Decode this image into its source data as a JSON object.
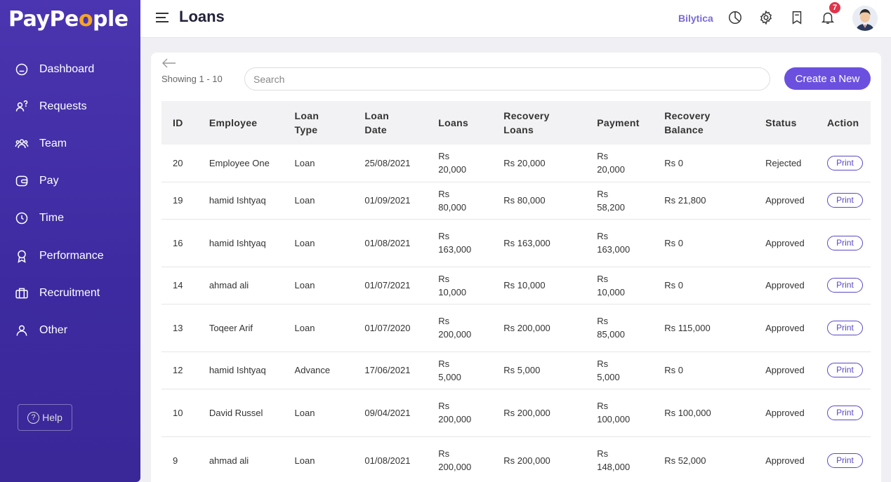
{
  "app": {
    "logo_pre": "PayPe",
    "logo_o": "o",
    "logo_post": "ple"
  },
  "sidebar": {
    "items": [
      {
        "label": "Dashboard",
        "icon": "dashboard-icon"
      },
      {
        "label": "Requests",
        "icon": "requests-icon"
      },
      {
        "label": "Team",
        "icon": "team-icon"
      },
      {
        "label": "Pay",
        "icon": "wallet-icon"
      },
      {
        "label": "Time",
        "icon": "clock-icon"
      },
      {
        "label": "Performance",
        "icon": "award-icon"
      },
      {
        "label": "Recruitment",
        "icon": "briefcase-icon"
      },
      {
        "label": "Other",
        "icon": "user-icon"
      }
    ],
    "help_label": "Help"
  },
  "header": {
    "title": "Loans",
    "company": "Bilytica",
    "notification_count": "7"
  },
  "toolbar": {
    "showing": "Showing 1 - 10",
    "search_placeholder": "Search",
    "create_label": "Create a New"
  },
  "table": {
    "columns": [
      "ID",
      "Employee",
      "Loan Type",
      "Loan Date",
      "Loans",
      "Recovery Loans",
      "Payment",
      "Recovery Balance",
      "Status",
      "Action"
    ],
    "rows": [
      {
        "id": "20",
        "employee": "Employee One",
        "type": "Loan",
        "date": "25/08/2021",
        "loans": "Rs 20,000",
        "recovery": "Rs 20,000",
        "payment": "Rs 20,000",
        "balance": "Rs 0",
        "status": "Rejected",
        "action": "Print"
      },
      {
        "id": "19",
        "employee": "hamid Ishtyaq",
        "type": "Loan",
        "date": "01/09/2021",
        "loans": "Rs 80,000",
        "recovery": "Rs 80,000",
        "payment": "Rs 58,200",
        "balance": "Rs 21,800",
        "status": "Approved",
        "action": "Print"
      },
      {
        "id": "16",
        "employee": "hamid Ishtyaq",
        "type": "Loan",
        "date": "01/08/2021",
        "loans": "Rs 163,000",
        "recovery": "Rs 163,000",
        "payment": "Rs 163,000",
        "balance": "Rs 0",
        "status": "Approved",
        "action": "Print"
      },
      {
        "id": "14",
        "employee": "ahmad ali",
        "type": "Loan",
        "date": "01/07/2021",
        "loans": "Rs 10,000",
        "recovery": "Rs 10,000",
        "payment": "Rs 10,000",
        "balance": "Rs 0",
        "status": "Approved",
        "action": "Print"
      },
      {
        "id": "13",
        "employee": "Toqeer Arif",
        "type": "Loan",
        "date": "01/07/2020",
        "loans": "Rs 200,000",
        "recovery": "Rs 200,000",
        "payment": "Rs 85,000",
        "balance": "Rs 115,000",
        "status": "Approved",
        "action": "Print"
      },
      {
        "id": "12",
        "employee": "hamid Ishtyaq",
        "type": "Advance",
        "date": "17/06/2021",
        "loans": "Rs 5,000",
        "recovery": "Rs 5,000",
        "payment": "Rs 5,000",
        "balance": "Rs 0",
        "status": "Approved",
        "action": "Print"
      },
      {
        "id": "10",
        "employee": "David Russel",
        "type": "Loan",
        "date": "09/04/2021",
        "loans": "Rs 200,000",
        "recovery": "Rs 200,000",
        "payment": "Rs 100,000",
        "balance": "Rs 100,000",
        "status": "Approved",
        "action": "Print"
      },
      {
        "id": "9",
        "employee": "ahmad ali",
        "type": "Loan",
        "date": "01/08/2021",
        "loans": "Rs 200,000",
        "recovery": "Rs 200,000",
        "payment": "Rs 148,000",
        "balance": "Rs 52,000",
        "status": "Approved",
        "action": "Print"
      }
    ]
  },
  "colors": {
    "sidebar": "#4b35b0",
    "accent": "#6b50e0",
    "badge": "#e0344a",
    "company": "#7b6ad6"
  }
}
